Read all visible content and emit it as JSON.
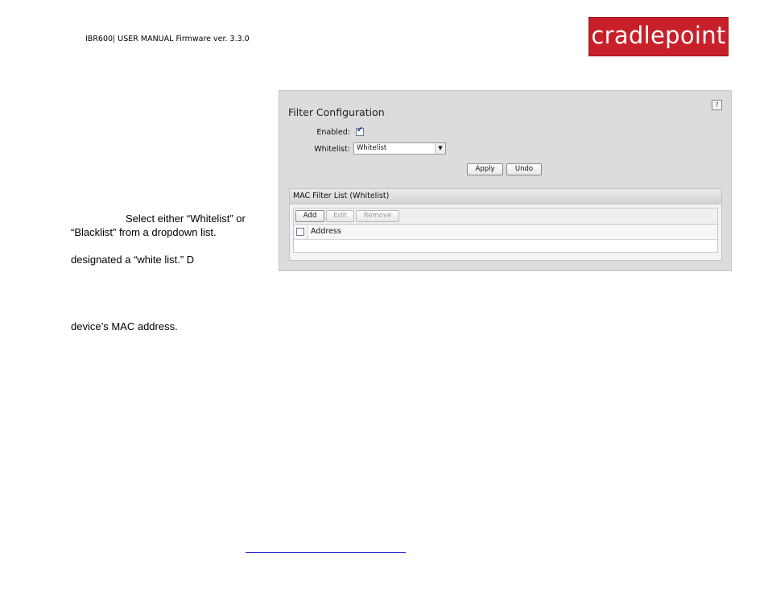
{
  "header": {
    "manual_title": "IBR600| USER MANUAL Firmware ver. 3.3.0",
    "logo_text": "cradlepoint"
  },
  "body_text": {
    "line1": "Select either “Whitelist” or",
    "line2": "“Blacklist” from a dropdown list.",
    "line3": "designated a “white list.” D",
    "line4": "device’s MAC address."
  },
  "filter_config": {
    "title": "Filter Configuration",
    "help_label": "?",
    "enabled_label": "Enabled:",
    "enabled": true,
    "whitelist_label": "Whitelist:",
    "whitelist_value": "Whitelist",
    "apply_label": "Apply",
    "undo_label": "Undo"
  },
  "mac_filter_list": {
    "title": "MAC Filter List (Whitelist)",
    "add_label": "Add",
    "edit_label": "Edit",
    "remove_label": "Remove",
    "columns": [
      "Address"
    ]
  }
}
